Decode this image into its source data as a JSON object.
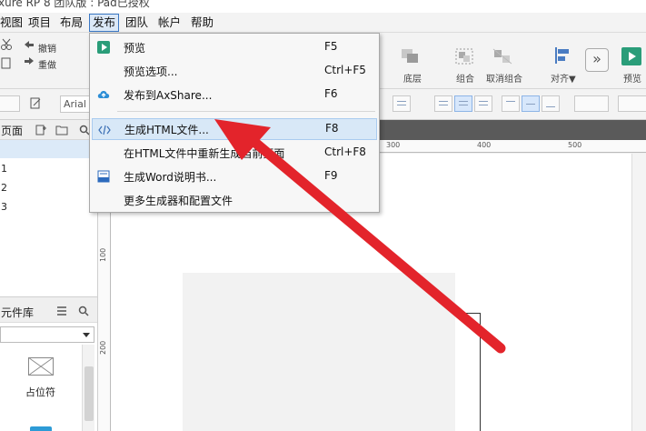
{
  "window": {
    "title": "xure RP 8 团队版 : Pad已授权"
  },
  "menubar": {
    "items": [
      {
        "label": "视图"
      },
      {
        "label": "项目"
      },
      {
        "label": "布局"
      },
      {
        "label": "发布",
        "active": true
      },
      {
        "label": "团队"
      },
      {
        "label": "帐户"
      },
      {
        "label": "帮助"
      }
    ]
  },
  "toolbar": {
    "undo": "撤销",
    "redo": "重做",
    "bottom_layer": "底层",
    "group": "组合",
    "ungroup": "取消组合",
    "align": "对齐▼",
    "preview": "预览"
  },
  "formatbar": {
    "font": "Arial"
  },
  "pages_panel": {
    "title": "页面",
    "rows": [
      "1",
      "2",
      "3"
    ]
  },
  "library_panel": {
    "title": "元件库",
    "widget_label": "占位符"
  },
  "rulers": {
    "top": [
      "300",
      "400",
      "500"
    ],
    "left": [
      "100",
      "200"
    ]
  },
  "publish_menu": {
    "items": [
      {
        "label": "预览",
        "shortcut": "F5",
        "icon": "preview-icon"
      },
      {
        "label": "预览选项...",
        "shortcut": "Ctrl+F5"
      },
      {
        "label": "发布到AxShare...",
        "shortcut": "F6",
        "icon": "cloud-upload-icon"
      },
      {
        "label": "生成HTML文件...",
        "shortcut": "F8",
        "icon": "code-icon",
        "highlighted": true
      },
      {
        "label": "在HTML文件中重新生成当前页面",
        "shortcut": "Ctrl+F8"
      },
      {
        "label": "生成Word说明书...",
        "shortcut": "F9",
        "icon": "word-doc-icon"
      },
      {
        "label": "更多生成器和配置文件",
        "shortcut": ""
      }
    ]
  },
  "colors": {
    "accent": "#3b78c4",
    "highlight": "#d8e8f7",
    "arrow": "#e3242b",
    "preview_green": "#2a9d79"
  }
}
